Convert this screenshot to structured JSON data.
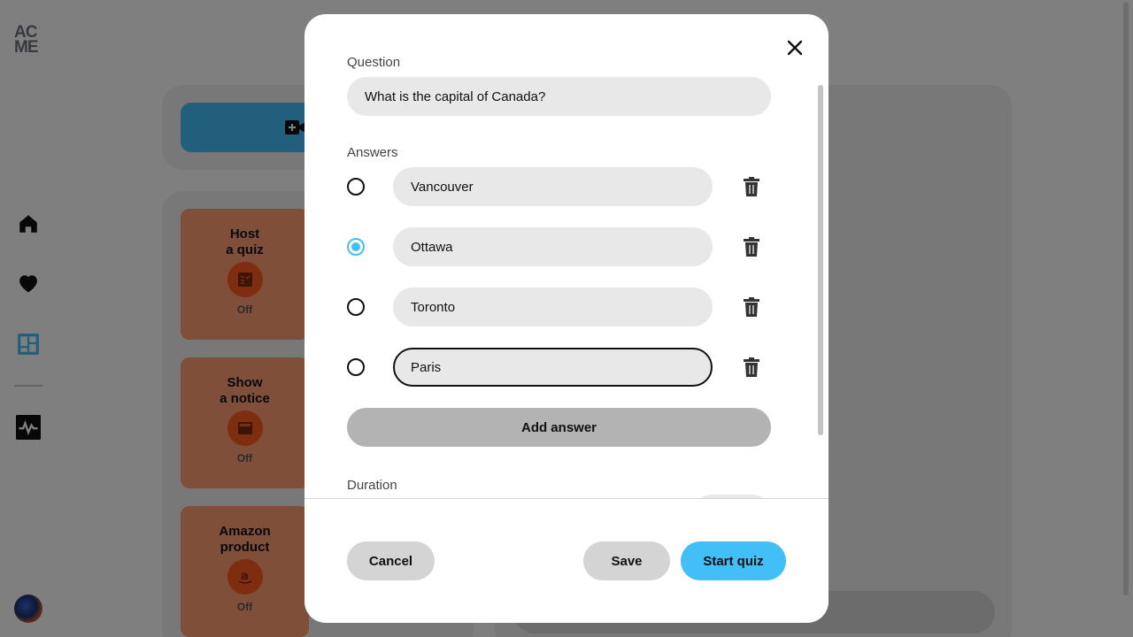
{
  "app": {
    "logo_line1": "AC",
    "logo_line2": "ME",
    "nav": [
      {
        "icon": "home-icon"
      },
      {
        "icon": "heart-icon"
      },
      {
        "icon": "dashboard-icon"
      },
      {
        "icon": "activity-icon"
      }
    ]
  },
  "widgets": [
    {
      "title_line1": "Host",
      "title_line2": "a quiz",
      "icon": "quiz-icon",
      "status": "Off"
    },
    {
      "title_line1": "Show",
      "title_line2": "a notice",
      "icon": "notice-icon",
      "status": "Off"
    },
    {
      "title_line1": "Amazon",
      "title_line2": "product",
      "icon": "amazon-icon",
      "status": "Off"
    }
  ],
  "modal": {
    "question_label": "Question",
    "question_value": "What is the capital of Canada?",
    "answers_label": "Answers",
    "answers": [
      {
        "text": "Vancouver",
        "correct": false
      },
      {
        "text": "Ottawa",
        "correct": true
      },
      {
        "text": "Toronto",
        "correct": false
      },
      {
        "text": "Paris",
        "correct": false,
        "focused": true
      }
    ],
    "add_answer_label": "Add answer",
    "duration_label": "Duration",
    "cancel_label": "Cancel",
    "save_label": "Save",
    "start_label": "Start quiz"
  },
  "colors": {
    "accent": "#43bff8",
    "widget_bg": "#ff9f75",
    "widget_icon_bg": "#ff5a22"
  }
}
